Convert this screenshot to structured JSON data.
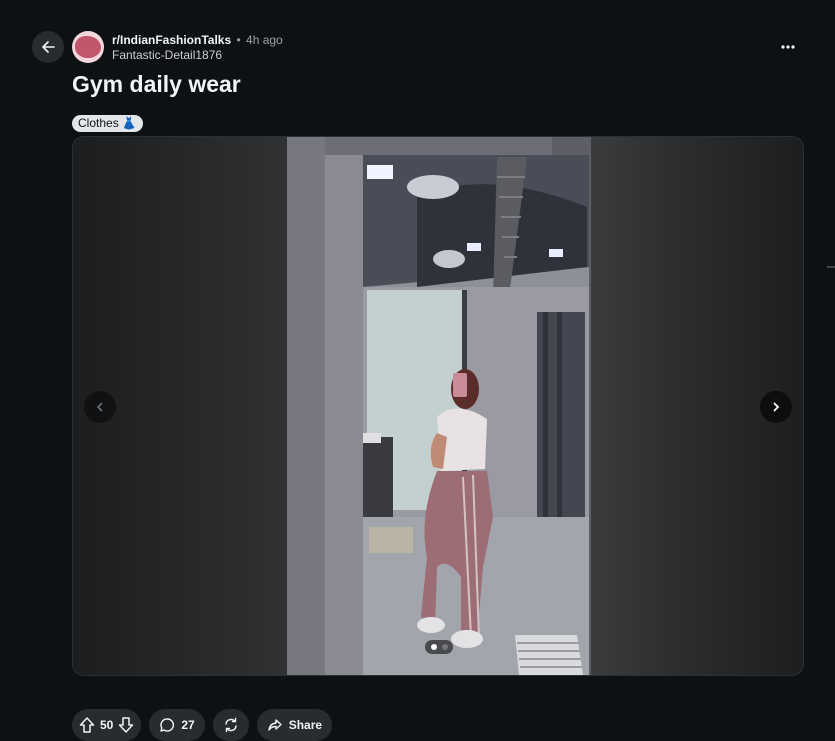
{
  "post": {
    "subreddit": "r/IndianFashionTalks",
    "separator": "•",
    "time": "4h ago",
    "author": "Fantastic-Detail1876",
    "title": "Gym daily wear",
    "flair": "Clothes",
    "flair_emoji": "👗"
  },
  "gallery": {
    "image_count": 2,
    "current_index": 1
  },
  "actions": {
    "votes": "50",
    "comments": "27",
    "share": "Share"
  },
  "icons": {
    "back": "arrow-left-icon",
    "more": "more-horizontal-icon",
    "prev": "chevron-left-icon",
    "next": "chevron-right-icon",
    "upvote": "upvote-arrow-icon",
    "downvote": "downvote-arrow-icon",
    "comment": "comment-bubble-icon",
    "crosspost": "crosspost-icon",
    "share": "share-arrow-icon"
  },
  "colors": {
    "background": "#0e1113",
    "button_bg": "#272c30",
    "flair_bg": "#e4e7ea",
    "avatar_accent": "#c2566a"
  }
}
